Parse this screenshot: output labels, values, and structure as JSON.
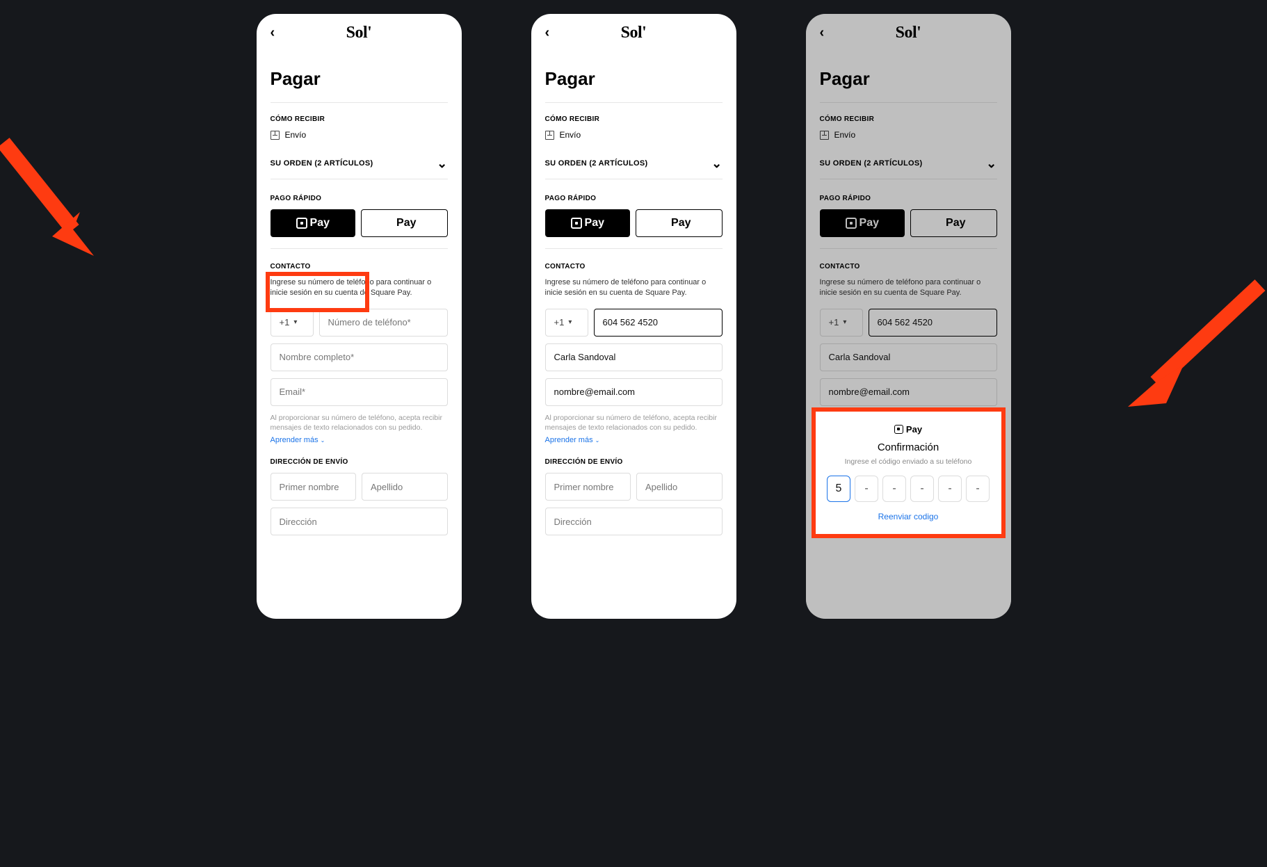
{
  "brand": "Sol'",
  "page_title": "Pagar",
  "sections": {
    "receive_label": "CÓMO RECIBIR",
    "ship_label": "Envío",
    "order_label": "SU ORDEN (2 ARTÍCULOS)",
    "fast_pay_label": "PAGO RÁPIDO",
    "square_pay_label": "Pay",
    "apple_pay_label": "Pay",
    "contact_label": "CONTACTO",
    "contact_desc": "Ingrese su número de teléfono para continuar o inicie sesión en su cuenta de Square Pay.",
    "country_code": "+1",
    "phone_placeholder": "Número de teléfono*",
    "name_placeholder": "Nombre completo*",
    "email_placeholder": "Email*",
    "fine_print": "Al proporcionar su número de teléfono, acepta recibir mensajes de texto relacionados con su pedido.",
    "learn_more": "Aprender más",
    "shipping_label": "DIRECCIÓN DE ENVÍO",
    "first_name_placeholder": "Primer nombre",
    "last_name_placeholder": "Apellido",
    "address_placeholder": "Dirección"
  },
  "filled": {
    "phone": "604 562 4520",
    "name": "Carla Sandoval",
    "email": "nombre@email.com"
  },
  "modal": {
    "brand": "Pay",
    "title": "Confirmación",
    "subtitle": "Ingrese el código enviado a su teléfono",
    "code_first": "5",
    "code_placeholder": "-",
    "resend": "Reenviar codigo"
  },
  "colors": {
    "highlight": "#fe3b11",
    "link": "#1a73e8"
  }
}
